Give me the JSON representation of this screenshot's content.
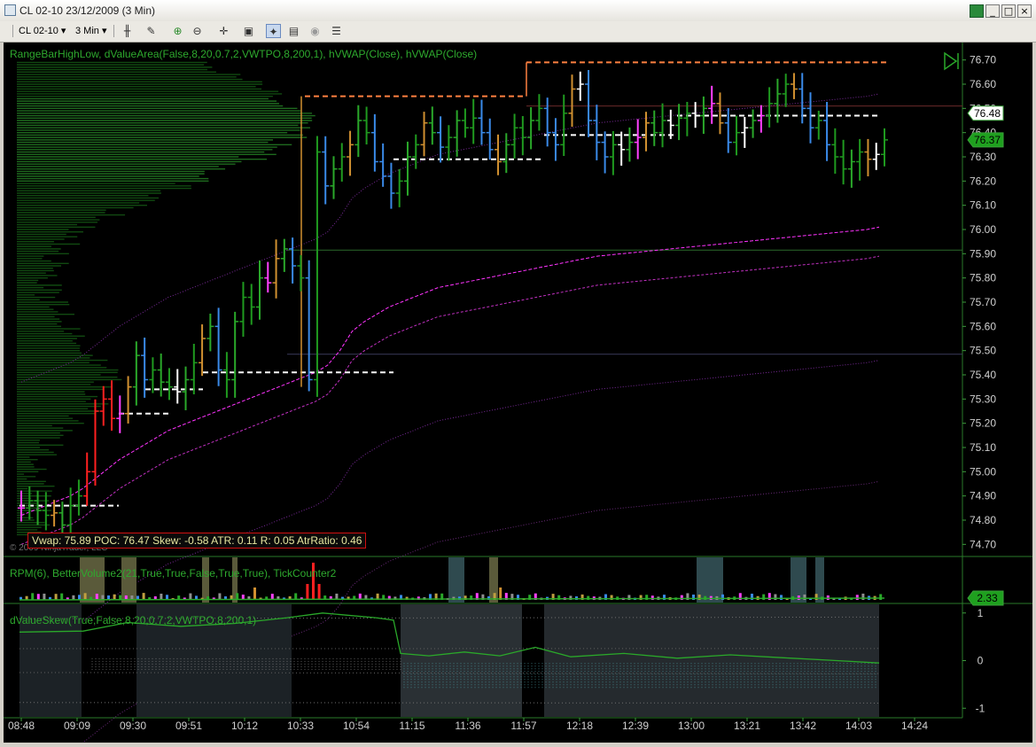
{
  "window": {
    "title": "CL 02-10  23/12/2009 (3 Min)"
  },
  "toolbar": {
    "instrument": "CL 02-10",
    "period": "3 Min"
  },
  "labels": {
    "indicators_top": "RangeBarHighLow,  dValueArea(False,8,20,0.7,2,VWTPO,8,200,1),  hVWAP(Close),  hVWAP(Close)",
    "indicators_mid": "RPM(6),  BetterVolume2(21,True,True,False,True,True),  TickCounter2",
    "indicators_low": "dValueSkew(True,False,8,20,0.7,2,VWTPO,8,200,1)",
    "copyright": "© 2009 NinjaTrader, LLC",
    "status": "Vwap: 75.89 POC: 76.47 Skew: -0.58 ATR: 0.11 R: 0.05 AtrRatio: 0.46"
  },
  "colors": {
    "grid": "#1e4a1e",
    "axis_text": "#3c9a3c",
    "vwap": "#ff33ff",
    "band": "#7a2a8a",
    "poc": "#ffffff",
    "up": "#1f9a1f",
    "down": "#3a8ae8",
    "accent_red": "#ff2020",
    "accent_orange": "#d09030"
  },
  "chart_data": {
    "type": "bar",
    "price_ticks": [
      "76.70",
      "76.60",
      "76.50",
      "76.40",
      "76.30",
      "76.20",
      "76.10",
      "76.00",
      "75.90",
      "75.80",
      "75.70",
      "75.60",
      "75.50",
      "75.40",
      "75.30",
      "75.20",
      "75.10",
      "75.00",
      "74.90",
      "74.80",
      "74.70"
    ],
    "price_min": 74.65,
    "price_max": 76.75,
    "time_ticks": [
      "08:48",
      "09:09",
      "09:30",
      "09:51",
      "10:12",
      "10:33",
      "10:54",
      "11:15",
      "11:36",
      "11:57",
      "12:18",
      "12:39",
      "13:00",
      "13:21",
      "13:42",
      "14:03",
      "14:24"
    ],
    "last_price_high": "76.48",
    "last_price": "76.37",
    "mid_value": "2.33",
    "skew_ticks": [
      "1",
      "0",
      "-1"
    ],
    "skew_range": [
      -1.2,
      1.2
    ],
    "closes": [
      74.85,
      74.88,
      74.84,
      74.82,
      74.83,
      74.78,
      74.86,
      74.9,
      75.0,
      75.25,
      75.3,
      75.22,
      75.24,
      75.35,
      75.48,
      75.38,
      75.42,
      75.37,
      75.35,
      75.33,
      75.38,
      75.45,
      75.55,
      75.6,
      75.42,
      75.38,
      75.62,
      75.72,
      75.68,
      75.8,
      75.78,
      75.88,
      75.92,
      75.85,
      75.8,
      75.38,
      76.32,
      76.18,
      76.25,
      76.3,
      76.35,
      76.45,
      76.4,
      76.28,
      76.22,
      76.15,
      76.2,
      76.3,
      76.35,
      76.44,
      76.4,
      76.34,
      76.38,
      76.45,
      76.42,
      76.46,
      76.4,
      76.33,
      76.28,
      76.35,
      76.42,
      76.38,
      76.45,
      76.5,
      76.4,
      76.35,
      76.48,
      76.58,
      76.6,
      76.45,
      76.36,
      76.3,
      76.35,
      76.33,
      76.36,
      76.38,
      76.44,
      76.4,
      76.45,
      76.43,
      76.46,
      76.48,
      76.47,
      76.5,
      76.52,
      76.44,
      76.36,
      76.4,
      76.42,
      76.45,
      76.47,
      76.52,
      76.56,
      76.6,
      76.58,
      76.5,
      76.42,
      76.45,
      76.35,
      76.3,
      76.25,
      76.28,
      76.32,
      76.29,
      76.31,
      76.37
    ],
    "vwap": [
      74.82,
      74.84,
      74.86,
      74.88,
      74.9,
      74.93,
      74.97,
      75.01,
      75.05,
      75.08,
      75.11,
      75.14,
      75.17,
      75.19,
      75.21,
      75.23,
      75.25,
      75.27,
      75.29,
      75.31,
      75.33,
      75.35,
      75.37,
      75.39,
      75.41,
      75.44,
      75.5,
      75.58,
      75.62,
      75.65,
      75.68,
      75.7,
      75.72,
      75.74,
      75.76,
      75.77,
      75.78,
      75.79,
      75.8,
      75.81,
      75.82,
      75.83,
      75.84,
      75.85,
      75.86,
      75.87,
      75.88,
      75.89,
      75.895,
      75.9,
      75.905,
      75.91,
      75.915,
      75.92,
      75.925,
      75.93,
      75.935,
      75.94,
      75.945,
      75.95,
      75.955,
      75.96,
      75.965,
      75.97,
      75.975,
      75.98,
      75.985,
      75.99,
      75.995,
      76.0,
      76.01
    ]
  }
}
